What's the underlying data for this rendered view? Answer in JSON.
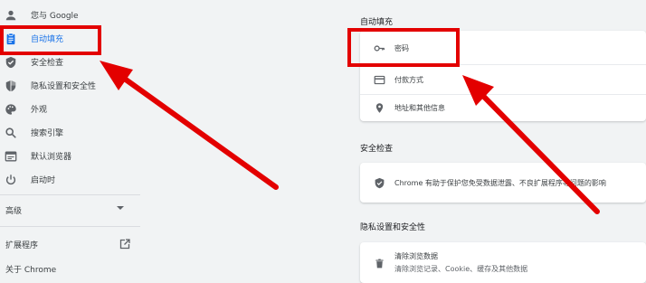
{
  "sidebar": {
    "items": [
      {
        "label": "您与 Google",
        "icon": "person-icon"
      },
      {
        "label": "自动填充",
        "icon": "autofill-clipboard-icon",
        "active": true
      },
      {
        "label": "安全检查",
        "icon": "shield-check-icon"
      },
      {
        "label": "隐私设置和安全性",
        "icon": "shield-lock-icon"
      },
      {
        "label": "外观",
        "icon": "palette-icon"
      },
      {
        "label": "搜索引擎",
        "icon": "search-icon"
      },
      {
        "label": "默认浏览器",
        "icon": "browser-window-icon"
      },
      {
        "label": "启动时",
        "icon": "power-icon"
      }
    ],
    "advanced_label": "高级",
    "extensions_label": "扩展程序",
    "about_label": "关于 Chrome"
  },
  "main": {
    "autofill": {
      "title": "自动填充",
      "rows": [
        {
          "label": "密码",
          "icon": "key-icon"
        },
        {
          "label": "付款方式",
          "icon": "credit-card-icon"
        },
        {
          "label": "地址和其他信息",
          "icon": "location-pin-icon"
        }
      ]
    },
    "safety": {
      "title": "安全检查",
      "text": "Chrome 有助于保护您免受数据泄露、不良扩展程序等问题的影响"
    },
    "privacy": {
      "title": "隐私设置和安全性",
      "row_title": "清除浏览数据",
      "row_sub": "清除浏览记录、Cookie、缓存及其他数据"
    }
  },
  "colors": {
    "accent": "#1a73e8",
    "annotation_red": "#e30000",
    "background": "#f1f3f4"
  }
}
